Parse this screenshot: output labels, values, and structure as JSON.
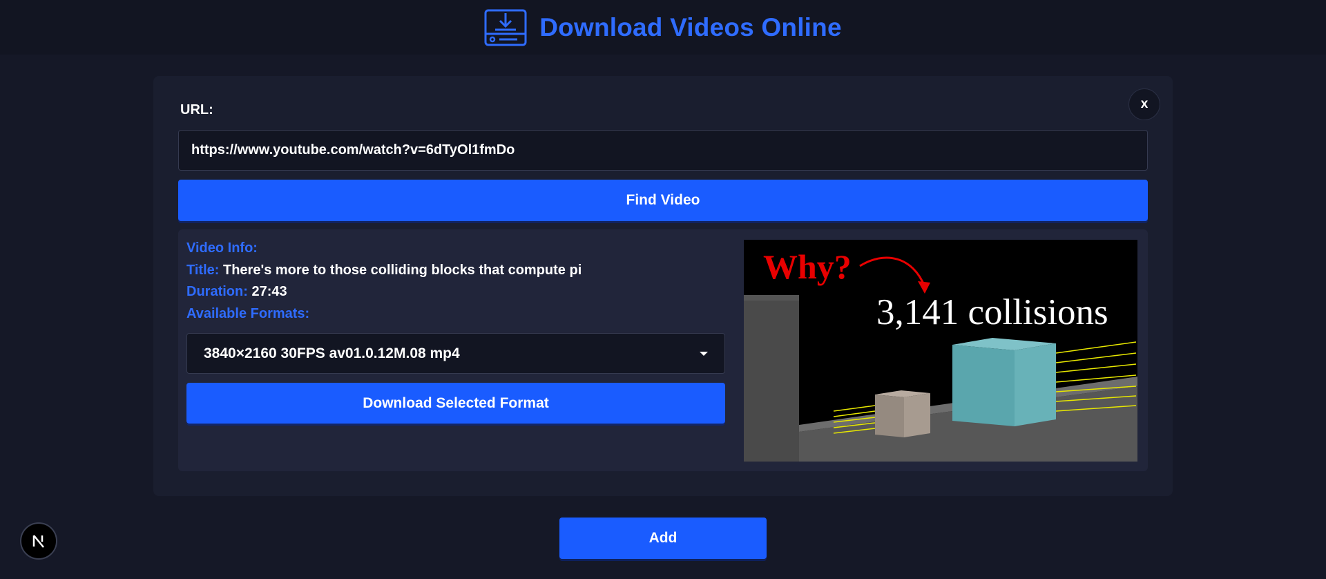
{
  "header": {
    "icon": "download-box-icon",
    "title": "Download Videos Online"
  },
  "form": {
    "close_label": "x",
    "url_label": "URL:",
    "url_value": "https://www.youtube.com/watch?v=6dTyOl1fmDo",
    "find_label": "Find Video"
  },
  "video_info": {
    "heading": "Video Info:",
    "title_label": "Title:",
    "title_value": "There's more to those colliding blocks that compute pi",
    "duration_label": "Duration:",
    "duration_value": "27:43",
    "formats_label": "Available Formats:",
    "selected_format": "3840×2160 30FPS av01.0.12M.08 mp4",
    "download_label": "Download Selected Format"
  },
  "thumbnail": {
    "question_text": "Why?",
    "collisions_text": "3,141 collisions"
  },
  "footer": {
    "add_label": "Add",
    "badge_icon": "nextjs-logo-icon"
  },
  "colors": {
    "accent": "#1a5cff",
    "accent_text": "#2f6cff",
    "background": "#151827",
    "panel": "#1a1e2f",
    "card": "#21253a"
  }
}
